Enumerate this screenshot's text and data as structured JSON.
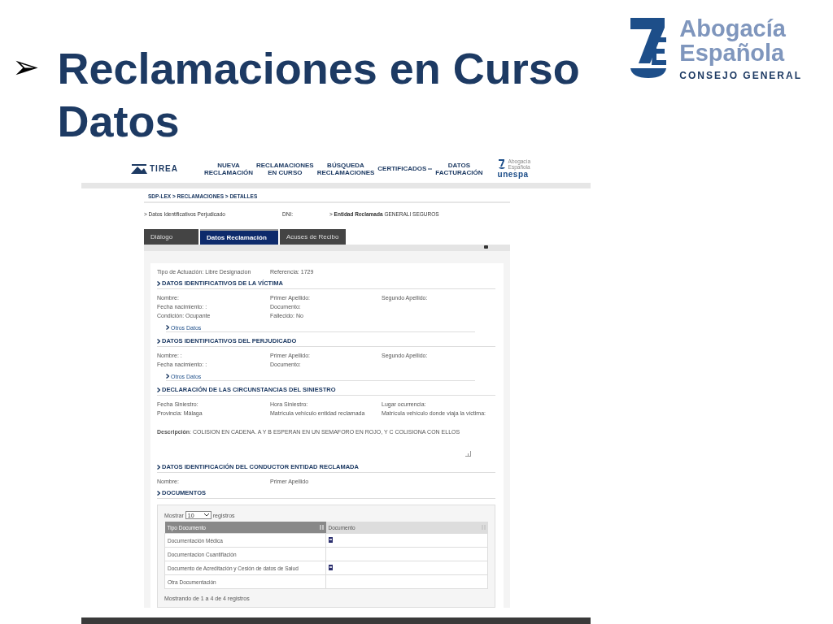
{
  "slide": {
    "bullet": "➢",
    "title_lines": [
      "Reclamaciones en Curso",
      "Datos"
    ],
    "logo": {
      "name_lines": [
        "Abogacía",
        "Española"
      ],
      "subtitle": "CONSEJO GENERAL"
    }
  },
  "app": {
    "brand": "TIREA",
    "nav": [
      {
        "lines": [
          "NUEVA",
          "RECLAMACIÓN"
        ],
        "has_menu": false
      },
      {
        "lines": [
          "RECLAMACIONES",
          "EN CURSO"
        ],
        "has_menu": false
      },
      {
        "lines": [
          "BÚSQUEDA",
          "RECLAMACIONES"
        ],
        "has_menu": false
      },
      {
        "lines": [
          "CERTIFICADOS"
        ],
        "has_menu": true
      },
      {
        "lines": [
          "DATOS",
          "FACTURACIÓN"
        ],
        "has_menu": false
      }
    ],
    "partner": {
      "lines": [
        "Abogacía",
        "Española"
      ],
      "name": "unespa"
    },
    "breadcrumb": "SDP-LEX > RECLAMACIONES > DETALLES",
    "info_bar": [
      "> Datos Identificativos Perjudicado",
      "DNI:",
      "> **Entidad Reclamada** GENERALI SEGUROS"
    ],
    "tabs": [
      {
        "label": "Diálogo",
        "selected": false
      },
      {
        "label": "Datos Reclamación",
        "selected": true
      },
      {
        "label": "Acuses de Recibo",
        "selected": false
      }
    ],
    "top_fields": [
      "Tipo de Actuación: Libre Designacion",
      "Referencia: 1729"
    ],
    "sections": [
      {
        "title": "DATOS IDENTIFICATIVOS DE LA VÍCTIMA",
        "rows": [
          [
            "Nombre:",
            "Primer Apellido:",
            "Segundo Apellido:"
          ],
          [
            "Fecha nacimiento: :",
            "Documento:"
          ],
          [
            "Condición: Ocupante",
            "Fallecido: No"
          ]
        ],
        "link": "Otros Datos"
      },
      {
        "title": "DATOS IDENTIFICATIVOS DEL PERJUDICADO",
        "rows": [
          [
            "Nombre: :",
            "Primer Apellido:",
            "Segundo Apellido:"
          ],
          [
            "Fecha nacimiento: :",
            "Documento:"
          ]
        ],
        "link": "Otros Datos"
      },
      {
        "title": "DECLARACIÓN DE LAS CIRCUNSTANCIAS DEL SINIESTRO",
        "rows": [
          [
            "Fecha Siniestro:",
            "Hora Siniestro:",
            "Lugar ocurrencia:"
          ],
          [
            "Provincia: Málaga",
            "Matrícula vehículo entidad reclamada",
            "Matrícula vehículo donde viaja la víctima:"
          ]
        ],
        "description": "**Descripción**: COLISION EN CADENA. A Y B ESPERAN EN UN SEMAFORO EN ROJO, Y C COLISIONA CON ELLOS"
      },
      {
        "title": "DATOS IDENTIFICACIÓN DEL CONDUCTOR ENTIDAD RECLAMADA",
        "rows": [
          [
            "Nombre:",
            "Primer Apellido"
          ]
        ]
      },
      {
        "title": "DOCUMENTOS",
        "table": {
          "length": {
            "before": "Mostrar",
            "value": "10",
            "after": "registros"
          },
          "columns": [
            {
              "label": "Tipo Documento",
              "sorted": true
            },
            {
              "label": "Documento",
              "sorted": false
            }
          ],
          "rows": [
            {
              "type": "Documentación Médica",
              "has_file": true
            },
            {
              "type": "Documentacion Cuantifiación",
              "has_file": false
            },
            {
              "type": "Documento de Acreditación y Cesión de datos de Salud",
              "has_file": true
            },
            {
              "type": "Otra Documentación",
              "has_file": false
            }
          ],
          "info": "Mostrando de 1 a 4 de 4 registros"
        }
      }
    ]
  }
}
